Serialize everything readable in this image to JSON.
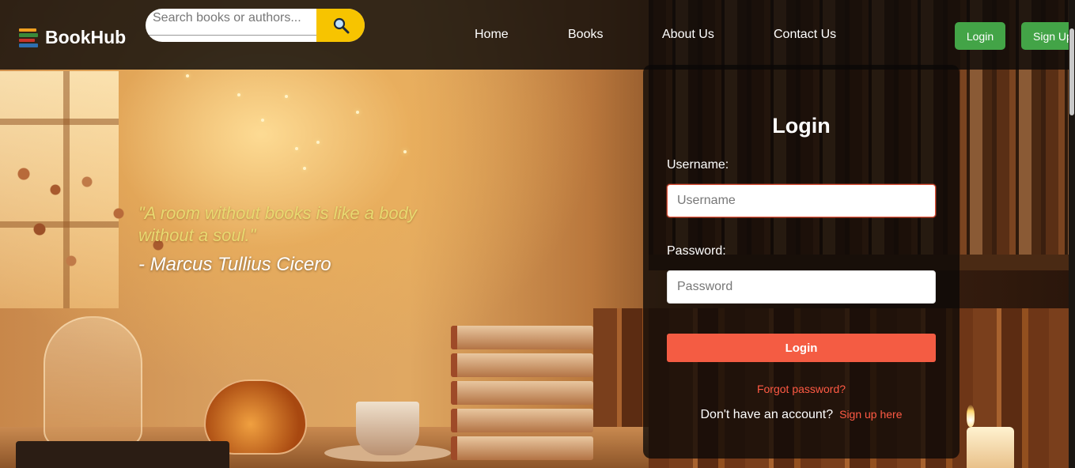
{
  "header": {
    "logo_text": "BookHub",
    "search_placeholder": "Search books or authors...",
    "nav": [
      "Home",
      "Books",
      "About Us",
      "Contact Us"
    ],
    "login_label": "Login",
    "signup_label": "Sign Up"
  },
  "hero": {
    "quote": "\"A room without books is like a body without a soul.\"",
    "author": "- Marcus Tullius Cicero"
  },
  "login_form": {
    "title": "Login",
    "username_label": "Username:",
    "username_placeholder": "Username",
    "password_label": "Password:",
    "password_placeholder": "Password",
    "submit_label": "Login",
    "forgot_link": "Forgot password?",
    "no_account_text": "Don't have an account?",
    "signup_link": "Sign up here"
  },
  "colors": {
    "accent_red": "#f45c43",
    "search_yellow": "#f7c400",
    "button_green": "#43a447",
    "quote_yellow": "#e8d870"
  },
  "icons": {
    "logo": "books-stack-icon",
    "search": "magnifier-icon"
  }
}
